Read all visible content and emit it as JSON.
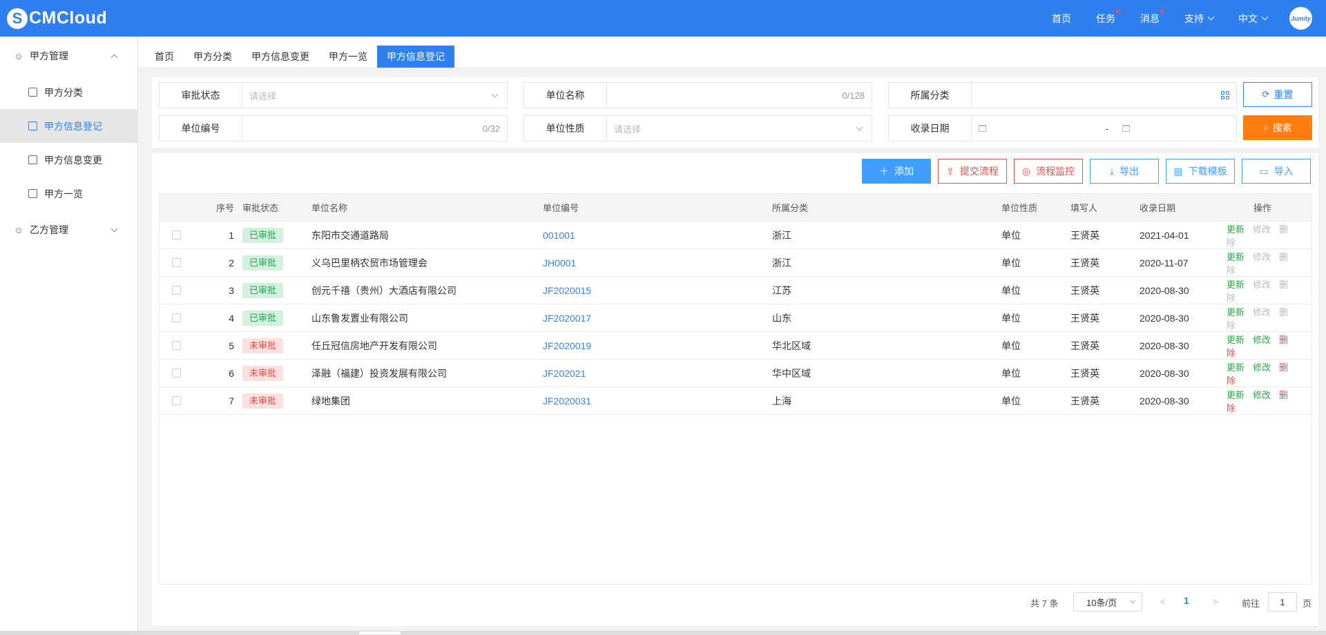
{
  "app": {
    "logo_text": "CMCloud"
  },
  "topnav": [
    {
      "label": "首页",
      "dot": false,
      "dropdown": false
    },
    {
      "label": "任务",
      "dot": true,
      "dropdown": false
    },
    {
      "label": "消息",
      "dot": true,
      "dropdown": false
    },
    {
      "label": "支持",
      "dot": false,
      "dropdown": true
    },
    {
      "label": "中文",
      "dot": false,
      "dropdown": true
    }
  ],
  "avatar_text": "Jumity",
  "sidebar": {
    "group1": "甲方管理",
    "items": [
      "甲方分类",
      "甲方信息登记",
      "甲方信息变更",
      "甲方一览"
    ],
    "active_item": "甲方信息登记",
    "group2": "乙方管理"
  },
  "tabs": [
    "首页",
    "甲方分类",
    "甲方信息变更",
    "甲方一览",
    "甲方信息登记"
  ],
  "active_tab": "甲方信息登记",
  "filters": {
    "status": {
      "label": "审批状态",
      "placeholder": "请选择"
    },
    "name": {
      "label": "单位名称",
      "count": "0/128"
    },
    "category": {
      "label": "所属分类"
    },
    "code": {
      "label": "单位编号",
      "count": "0/32"
    },
    "nature": {
      "label": "单位性质",
      "placeholder": "请选择"
    },
    "date": {
      "label": "收录日期",
      "separator": "-"
    }
  },
  "buttons": {
    "reset": "重置",
    "search": "搜索",
    "add": "添加",
    "submit_flow": "提交流程",
    "monitor_flow": "流程监控",
    "export": "导出",
    "download_template": "下载模板",
    "import": "导入"
  },
  "table": {
    "columns": [
      "序号",
      "审批状态",
      "单位名称",
      "单位编号",
      "所属分类",
      "单位性质",
      "填写人",
      "收录日期",
      "操作"
    ],
    "rows": [
      {
        "no": "1",
        "status": "已审批",
        "approved": true,
        "name": "东阳市交通道路局",
        "code": "001001",
        "category": "浙江",
        "nature": "单位",
        "writer": "王贤英",
        "date": "2021-04-01"
      },
      {
        "no": "2",
        "status": "已审批",
        "approved": true,
        "name": "义乌巴里柄农贸市场管理会",
        "code": "JH0001",
        "category": "浙江",
        "nature": "单位",
        "writer": "王贤英",
        "date": "2020-11-07"
      },
      {
        "no": "3",
        "status": "已审批",
        "approved": true,
        "name": "创元千禧（贵州）大酒店有限公司",
        "code": "JF2020015",
        "category": "江苏",
        "nature": "单位",
        "writer": "王贤英",
        "date": "2020-08-30"
      },
      {
        "no": "4",
        "status": "已审批",
        "approved": true,
        "name": "山东鲁发置业有限公司",
        "code": "JF2020017",
        "category": "山东",
        "nature": "单位",
        "writer": "王贤英",
        "date": "2020-08-30"
      },
      {
        "no": "5",
        "status": "未审批",
        "approved": false,
        "name": "任丘冠信房地产开发有限公司",
        "code": "JF2020019",
        "category": "华北区域",
        "nature": "单位",
        "writer": "王贤英",
        "date": "2020-08-30"
      },
      {
        "no": "6",
        "status": "未审批",
        "approved": false,
        "name": "泽融（福建）投资发展有限公司",
        "code": "JF202021",
        "category": "华中区域",
        "nature": "单位",
        "writer": "王贤英",
        "date": "2020-08-30"
      },
      {
        "no": "7",
        "status": "未审批",
        "approved": false,
        "name": "绿地集团",
        "code": "JF2020031",
        "category": "上海",
        "nature": "单位",
        "writer": "王贤英",
        "date": "2020-08-30"
      }
    ],
    "ops": {
      "update": "更新",
      "edit": "修改",
      "delete": "删除"
    }
  },
  "pager": {
    "total": "共 7 条",
    "page_size": "10条/页",
    "current_page": "1",
    "goto_label": "前往",
    "goto_value": "1",
    "page_suffix": "页"
  },
  "colors": {
    "primary": "#2f7ff1",
    "orange": "#ff7e0f",
    "red": "#f04848",
    "green": "#28a745"
  }
}
